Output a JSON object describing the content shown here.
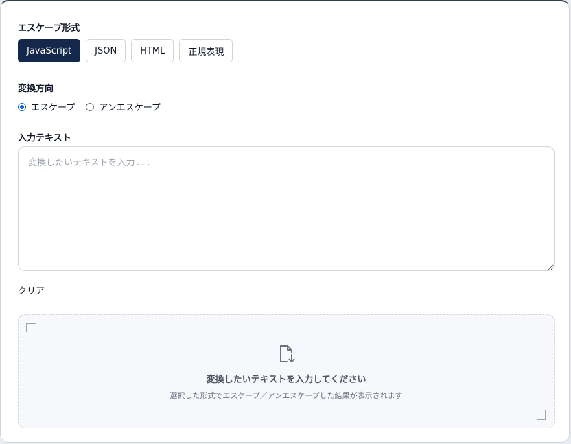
{
  "format": {
    "label": "エスケープ形式",
    "options": [
      "JavaScript",
      "JSON",
      "HTML",
      "正規表現"
    ],
    "selected": "JavaScript"
  },
  "direction": {
    "label": "変換方向",
    "options": [
      "エスケープ",
      "アンエスケープ"
    ],
    "selected": "エスケープ"
  },
  "input": {
    "label": "入力テキスト",
    "placeholder": "変換したいテキストを入力...",
    "value": ""
  },
  "clear_label": "クリア",
  "result": {
    "icon": "file-download-icon",
    "title": "変換したいテキストを入力してください",
    "subtitle": "選択した形式でエスケープ／アンエスケープした結果が表示されます"
  },
  "colors": {
    "accent": "#13284a",
    "radio": "#0b62d6"
  }
}
